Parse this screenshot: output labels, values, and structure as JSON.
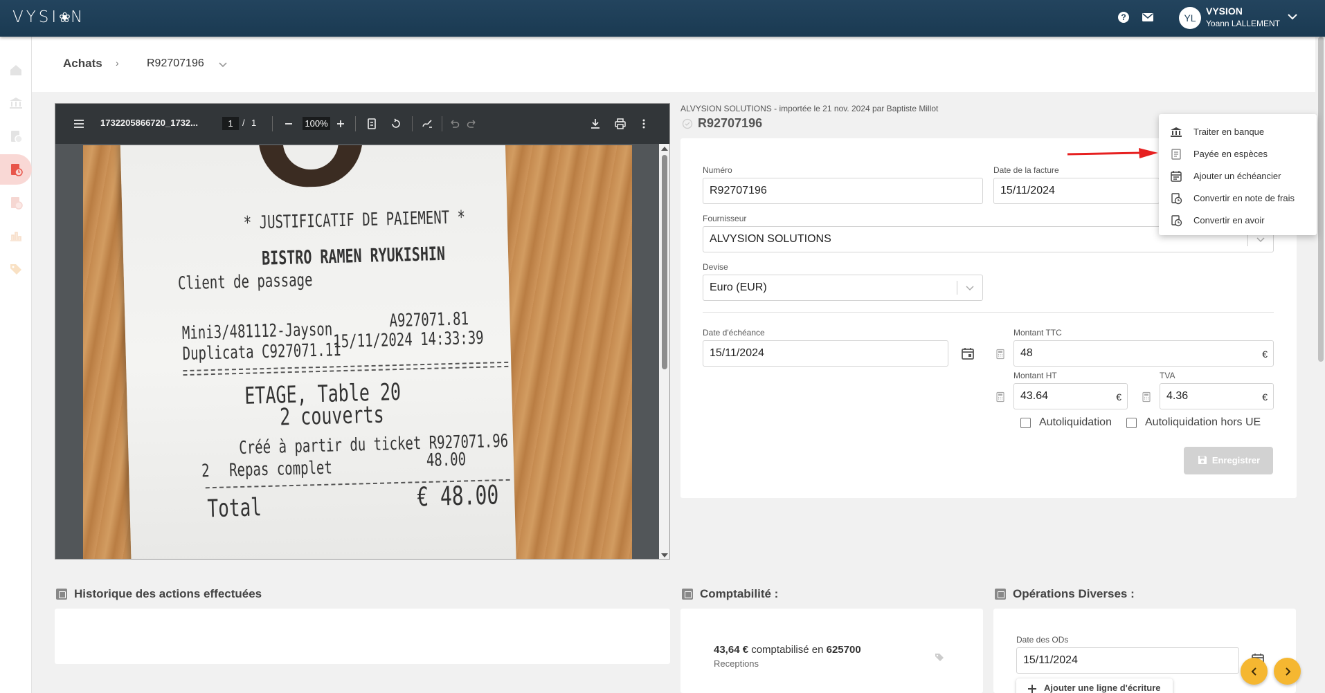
{
  "app": {
    "logo_text": "VYSI",
    "logo_mark": "❀",
    "logo_tail": "N"
  },
  "user": {
    "initials": "YL",
    "org": "VYSION",
    "name": "Yoann LALLEMENT"
  },
  "breadcrumb": {
    "section": "Achats",
    "separator": "›",
    "document": "R92707196"
  },
  "pdf_viewer": {
    "filename": "1732205866720_1732...",
    "page_current": "1",
    "page_separator": "/",
    "page_total": "1",
    "zoom": "100%"
  },
  "receipt": {
    "line1": "* JUSTIFICATIF DE PAIEMENT *",
    "line2": "BISTRO RAMEN RYUKISHIN",
    "line3": "Client de passage",
    "line4a": "Mini3/481112-Jayson",
    "line4b": "A927071.81",
    "line5a": "Duplicata C927071.11",
    "line5b": "15/11/2024 14:33:39",
    "line6": "ETAGE, Table 20",
    "line7": "2 couverts",
    "line8": "Créé à partir du ticket R927071.96",
    "line9a": "2",
    "line9b": "Repas complet",
    "line9c": "48.00",
    "line10a": "Total",
    "line10b": "€ 48.00"
  },
  "document": {
    "meta": "ALVYSION SOLUTIONS - importée le 21 nov. 2024 par Baptiste Millot",
    "id": "R92707196"
  },
  "form": {
    "numero_label": "Numéro",
    "numero_value": "R92707196",
    "date_facture_label": "Date de la facture",
    "date_facture_value": "15/11/2024",
    "fournisseur_label": "Fournisseur",
    "fournisseur_value": "ALVYSION SOLUTIONS",
    "devise_label": "Devise",
    "devise_value": "Euro (EUR)",
    "echeance_label": "Date d'échéance",
    "echeance_value": "15/11/2024",
    "ttc_label": "Montant TTC",
    "ttc_value": "48",
    "ht_label": "Montant HT",
    "ht_value": "43.64",
    "tva_label": "TVA",
    "tva_value": "4.36",
    "currency_symbol": "€",
    "autoliquidation_label": "Autoliquidation",
    "autoliquidation_hors_ue_label": "Autoliquidation hors UE",
    "save_label": "Enregistrer"
  },
  "menu": {
    "items": [
      {
        "label": "Traiter en banque",
        "icon": "bank-icon"
      },
      {
        "label": "Payée en espèces",
        "icon": "cash-icon"
      },
      {
        "label": "Ajouter un échéancier",
        "icon": "calendar-icon"
      },
      {
        "label": "Convertir en note de frais",
        "icon": "expense-icon"
      },
      {
        "label": "Convertir en avoir",
        "icon": "credit-note-icon"
      }
    ]
  },
  "history": {
    "title": "Historique des actions effectuées"
  },
  "comptabilite": {
    "title": "Comptabilité :",
    "amount": "43,64 €",
    "text": "comptabilisé en",
    "account": "625700",
    "sub": "Receptions"
  },
  "od": {
    "title": "Opérations Diverses :",
    "date_label": "Date des ODs",
    "date_value": "15/11/2024",
    "add_line": "Ajouter une ligne d'écriture"
  },
  "colors": {
    "topbar": "#1f3f58",
    "accent": "#e8564b",
    "nav_button": "#f5b731"
  }
}
